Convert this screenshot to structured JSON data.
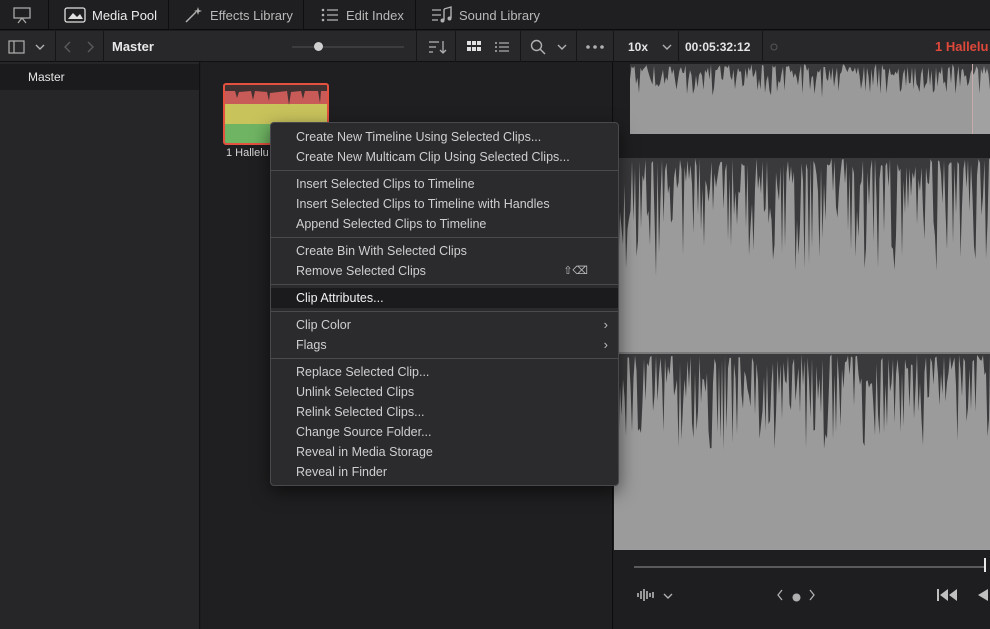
{
  "toolbar": {
    "media_pool": "Media Pool",
    "effects_library": "Effects Library",
    "edit_index": "Edit Index",
    "sound_library": "Sound Library"
  },
  "header": {
    "bin_title": "Master",
    "zoom": "10x",
    "timecode": "00:05:32:12",
    "clip_name": "1 Hallelu"
  },
  "sidebar": {
    "items": [
      {
        "label": "Master"
      }
    ]
  },
  "pool": {
    "clips": [
      {
        "label": "1 Hallelu"
      }
    ]
  },
  "context_menu": {
    "groups": [
      [
        "Create New Timeline Using Selected Clips...",
        "Create New Multicam Clip Using Selected Clips..."
      ],
      [
        "Insert Selected Clips to Timeline",
        "Insert Selected Clips to Timeline with Handles",
        "Append Selected Clips to Timeline"
      ],
      [
        "Create Bin With Selected Clips",
        "Remove Selected Clips"
      ],
      [
        "Clip Attributes..."
      ],
      [
        "Clip Color",
        "Flags"
      ],
      [
        "Replace Selected Clip...",
        "Unlink Selected Clips",
        "Relink Selected Clips...",
        "Change Source Folder...",
        "Reveal in Media Storage",
        "Reveal in Finder"
      ]
    ],
    "remove_shortcut": "⇧⌫",
    "highlighted": "Clip Attributes..."
  },
  "colors": {
    "accent_red": "#e0483a",
    "selection_border": "#e4513f"
  }
}
